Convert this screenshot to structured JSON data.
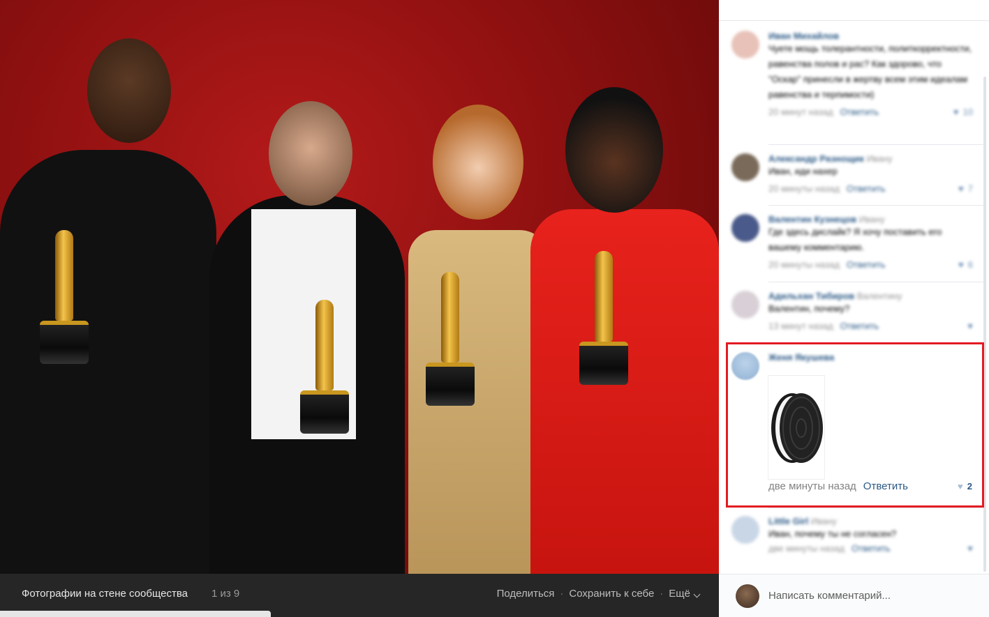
{
  "photo": {
    "album_title": "Фотографии на стене сообщества",
    "counter": "1 из 9"
  },
  "photo_actions": {
    "share": "Поделиться",
    "save": "Сохранить к себе",
    "more": "Ещё"
  },
  "comments": [
    {
      "name": "Иван Михайлов",
      "to": "",
      "text": "Чуете мощь толерантности, политкорректности, равенства полов и рас? Как здорово, что \"Оскар\" принесли в жертву всем этим идеалам равенства и терпимости)",
      "time": "20 минут назад",
      "reply": "Ответить",
      "likes": "10",
      "blurred": true
    },
    {
      "name": "Александр Разнощик",
      "to": "Ивану",
      "text": "Иван, иди нахер",
      "time": "20 минуты назад",
      "reply": "Ответить",
      "likes": "7",
      "blurred": true
    },
    {
      "name": "Валентин Кузнецов",
      "to": "Ивану",
      "text": "Где здесь дислайк? Я хочу поставить его вашему комментарию.",
      "time": "20 минуты назад",
      "reply": "Ответить",
      "likes": "6",
      "blurred": true
    },
    {
      "name": "Адильхан Тибиров",
      "to": "Валентину",
      "text": "Валентин, почему?",
      "time": "13 минут назад",
      "reply": "Ответить",
      "likes": "",
      "blurred": true
    },
    {
      "name": "Женя Якушева",
      "to": "",
      "text": "",
      "time": "две минуты назад",
      "reply": "Ответить",
      "likes": "2",
      "blurred": false
    },
    {
      "name": "Little Girl",
      "to": "Ивану",
      "text": "Иван, почему ты не согласен?",
      "time": "две минуты назад",
      "reply": "Ответить",
      "likes": "",
      "blurred": true
    }
  ],
  "compose": {
    "placeholder": "Написать комментарий..."
  },
  "colors": {
    "link": "#2a5885",
    "highlight": "#e31b23",
    "photo_bar": "#262626"
  }
}
